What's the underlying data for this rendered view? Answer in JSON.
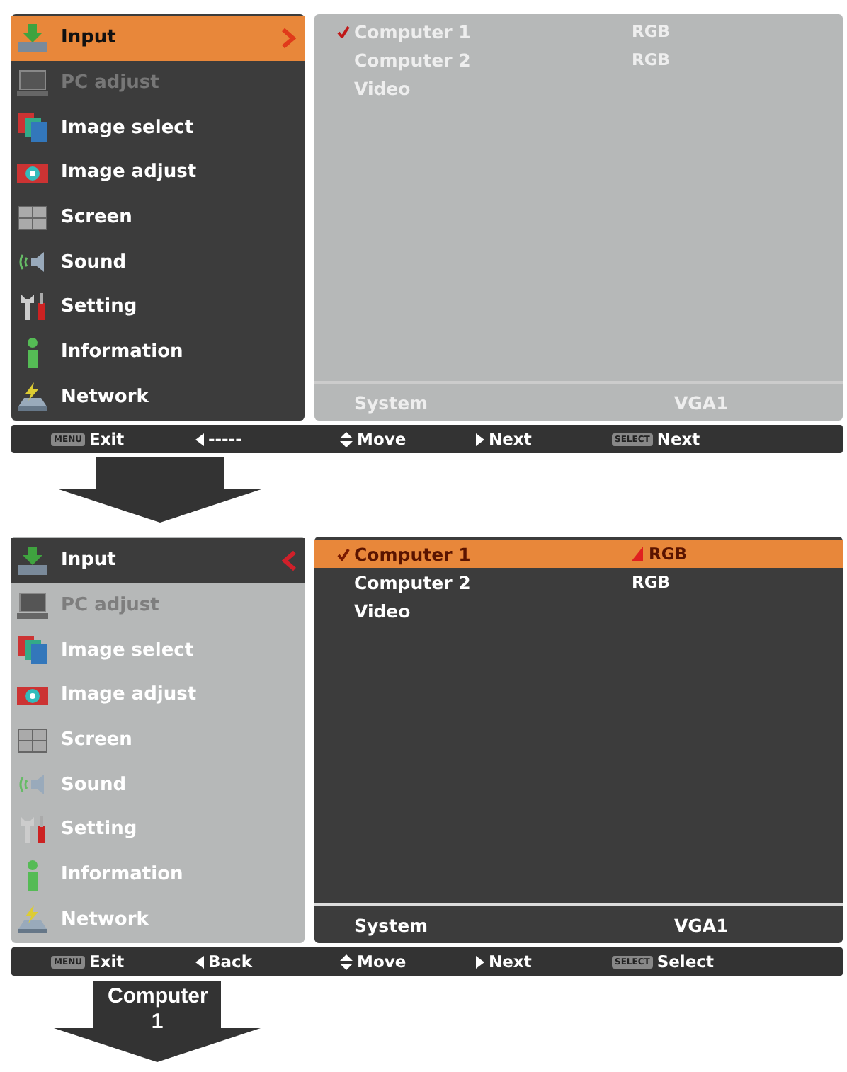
{
  "screens": [
    {
      "menu_active": true,
      "menu": [
        {
          "label": "Input",
          "kind": "input",
          "selected": true,
          "disabled": false
        },
        {
          "label": "PC adjust",
          "kind": "pc",
          "selected": false,
          "disabled": true
        },
        {
          "label": "Image select",
          "kind": "imgsel",
          "selected": false,
          "disabled": false
        },
        {
          "label": "Image adjust",
          "kind": "imgadj",
          "selected": false,
          "disabled": false
        },
        {
          "label": "Screen",
          "kind": "screen",
          "selected": false,
          "disabled": false
        },
        {
          "label": "Sound",
          "kind": "sound",
          "selected": false,
          "disabled": false
        },
        {
          "label": "Setting",
          "kind": "setting",
          "selected": false,
          "disabled": false
        },
        {
          "label": "Information",
          "kind": "info",
          "selected": false,
          "disabled": false
        },
        {
          "label": "Network",
          "kind": "network",
          "selected": false,
          "disabled": false
        }
      ],
      "submenu": [
        {
          "label": "Computer 1",
          "value": "RGB",
          "checked": true,
          "selected": false,
          "marker": false
        },
        {
          "label": "Computer 2",
          "value": "RGB",
          "checked": false,
          "selected": false,
          "marker": false
        },
        {
          "label": "Video",
          "checked": false,
          "selected": false,
          "marker": false
        }
      ],
      "system": {
        "label": "System",
        "value": "VGA1"
      },
      "footer": [
        {
          "kind": "key",
          "key": "MENU",
          "label": "Exit"
        },
        {
          "kind": "left",
          "label": "-----"
        },
        {
          "kind": "updown",
          "label": "Move"
        },
        {
          "kind": "right",
          "label": "Next"
        },
        {
          "kind": "key",
          "key": "SELECT",
          "label": "Next"
        }
      ]
    },
    {
      "menu_active": false,
      "menu": [
        {
          "label": "Input",
          "kind": "input",
          "selected": true,
          "disabled": false
        },
        {
          "label": "PC adjust",
          "kind": "pc",
          "selected": false,
          "disabled": true
        },
        {
          "label": "Image select",
          "kind": "imgsel",
          "selected": false,
          "disabled": false
        },
        {
          "label": "Image adjust",
          "kind": "imgadj",
          "selected": false,
          "disabled": false
        },
        {
          "label": "Screen",
          "kind": "screen",
          "selected": false,
          "disabled": false
        },
        {
          "label": "Sound",
          "kind": "sound",
          "selected": false,
          "disabled": false
        },
        {
          "label": "Setting",
          "kind": "setting",
          "selected": false,
          "disabled": false
        },
        {
          "label": "Information",
          "kind": "info",
          "selected": false,
          "disabled": false
        },
        {
          "label": "Network",
          "kind": "network",
          "selected": false,
          "disabled": false
        }
      ],
      "submenu": [
        {
          "label": "Computer 1",
          "value": "RGB",
          "checked": true,
          "selected": true,
          "marker": true
        },
        {
          "label": "Computer 2",
          "value": "RGB",
          "checked": false,
          "selected": false,
          "marker": false
        },
        {
          "label": "Video",
          "checked": false,
          "selected": false,
          "marker": false
        }
      ],
      "system": {
        "label": "System",
        "value": "VGA1"
      },
      "footer": [
        {
          "kind": "key",
          "key": "MENU",
          "label": "Exit"
        },
        {
          "kind": "left",
          "label": "Back"
        },
        {
          "kind": "updown",
          "label": "Move"
        },
        {
          "kind": "right",
          "label": "Next"
        },
        {
          "kind": "key",
          "key": "SELECT",
          "label": "Select"
        }
      ]
    }
  ],
  "arrows": [
    {},
    {
      "label": "Computer 1"
    }
  ]
}
